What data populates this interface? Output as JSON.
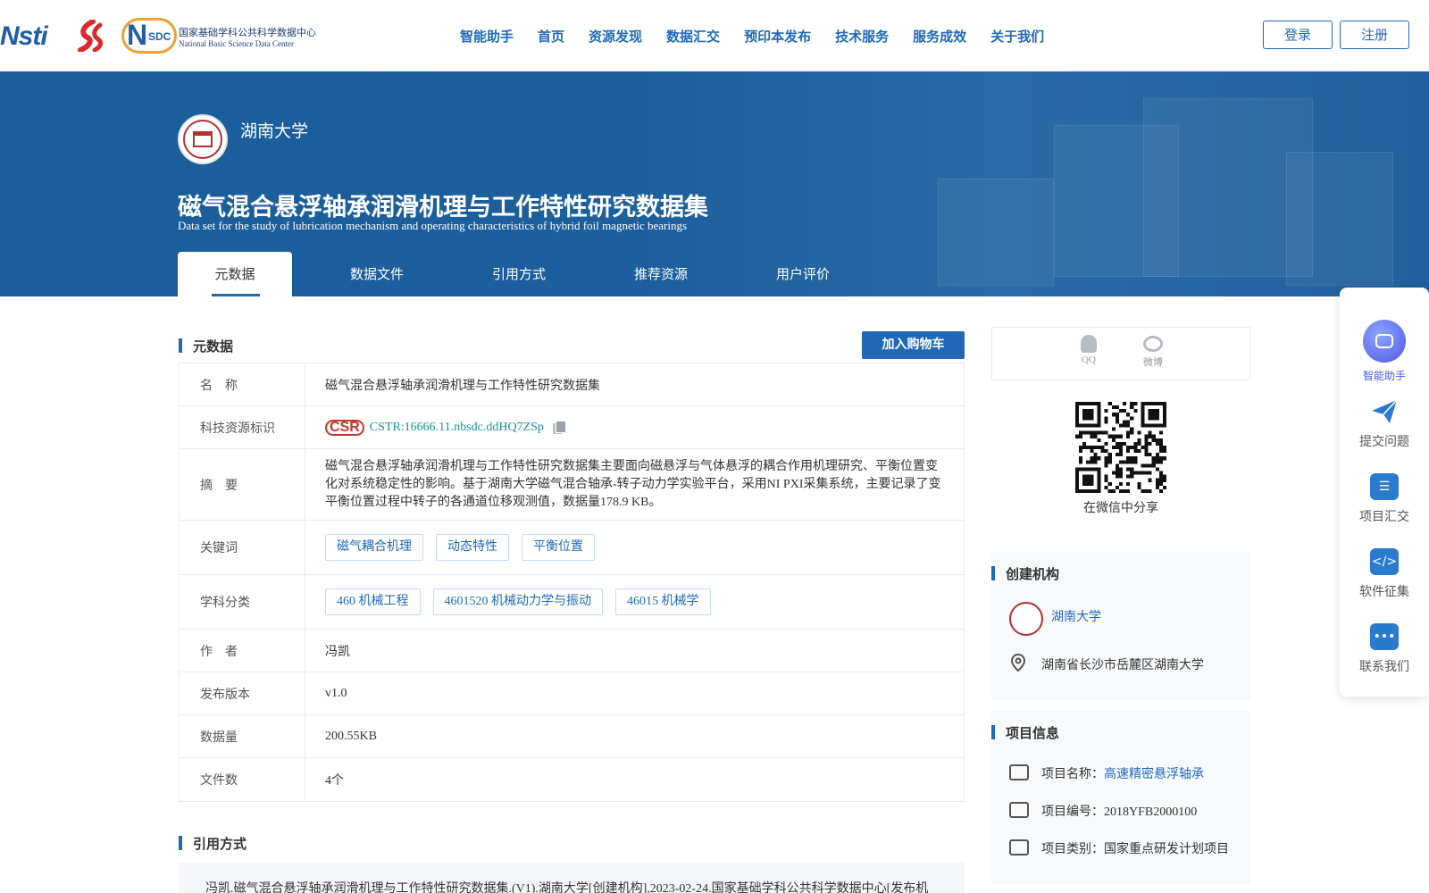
{
  "header": {
    "logo_nsti": "Nsti",
    "logo_nsdc_cn": "国家基础学科公共科学数据中心",
    "logo_nsdc_en": "National Basic Science Data Center",
    "nav": [
      "智能助手",
      "首页",
      "资源发现",
      "数据汇交",
      "预印本发布",
      "技术服务",
      "服务成效",
      "关于我们"
    ],
    "login": "登录",
    "register": "注册"
  },
  "banner": {
    "institution": "湖南大学",
    "title": "磁气混合悬浮轴承润滑机理与工作特性研究数据集",
    "subtitle": "Data set for the study of lubrication mechanism and operating characteristics of hybrid foil magnetic bearings",
    "tabs": [
      "元数据",
      "数据文件",
      "引用方式",
      "推荐资源",
      "用户评价"
    ]
  },
  "metadata": {
    "heading": "元数据",
    "cart_button": "加入购物车",
    "rows": {
      "name_label": "名　称",
      "name_value": "磁气混合悬浮轴承润滑机理与工作特性研究数据集",
      "id_label": "科技资源标识",
      "id_value": "CSTR:16666.11.nbsdc.ddHQ7ZSp",
      "id_logo": "CSR",
      "abstract_label": "摘　要",
      "abstract_value": "磁气混合悬浮轴承润滑机理与工作特性研究数据集主要面向磁悬浮与气体悬浮的耦合作用机理研究、平衡位置变化对系统稳定性的影响。基于湖南大学磁气混合轴承-转子动力学实验平台，采用NI PXI采集系统，主要记录了变平衡位置过程中转子的各通道位移观测值，数据量178.9 KB。",
      "keywords_label": "关键词",
      "keywords": [
        "磁气耦合机理",
        "动态特性",
        "平衡位置"
      ],
      "subject_label": "学科分类",
      "subjects": [
        "460 机械工程",
        "4601520 机械动力学与振动",
        "46015 机械学"
      ],
      "author_label": "作　者",
      "author_value": "冯凯",
      "version_label": "发布版本",
      "version_value": "v1.0",
      "size_label": "数据量",
      "size_value": "200.55KB",
      "files_label": "文件数",
      "files_value": "4个"
    }
  },
  "citation": {
    "heading": "引用方式",
    "text": "冯凯.磁气混合悬浮轴承润滑机理与工作特性研究数据集.(V1).湖南大学[创建机构],2023-02-24.国家基础学科公共科学数据中心[发布机"
  },
  "share": {
    "qq": "QQ",
    "weibo": "微博",
    "wechat": "在微信中分享"
  },
  "org": {
    "heading": "创建机构",
    "name": "湖南大学",
    "address": "湖南省长沙市岳麓区湖南大学"
  },
  "project": {
    "heading": "项目信息",
    "name_label": "项目名称：",
    "name_value": "高速精密悬浮轴承",
    "code_label": "项目编号：",
    "code_value": "2018YFB2000100",
    "type_label": "项目类别：",
    "type_value": "国家重点研发计划项目"
  },
  "float_bar": {
    "assistant": "智能助手",
    "items": [
      "提交问题",
      "项目汇交",
      "软件征集",
      "联系我们"
    ]
  }
}
